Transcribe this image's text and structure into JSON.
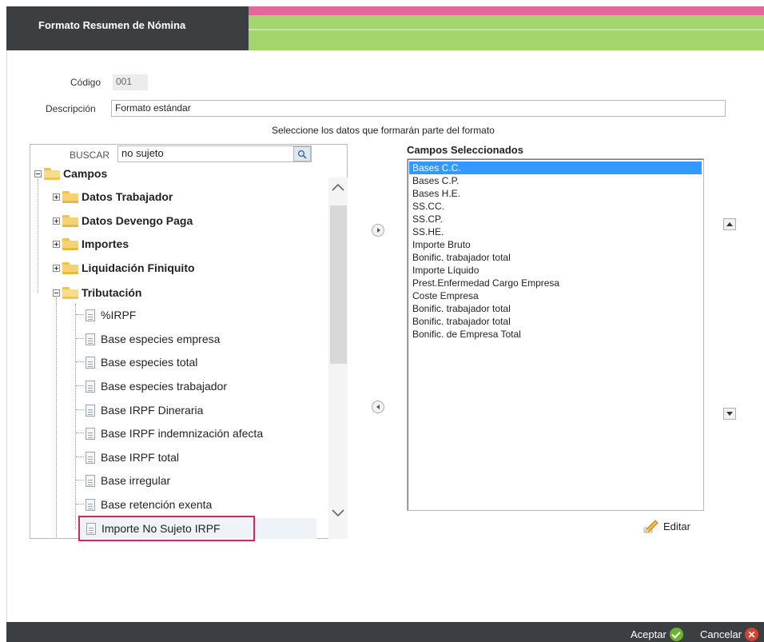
{
  "header": {
    "title": "Formato Resumen de Nómina"
  },
  "form": {
    "codigo_label": "Código",
    "codigo_value": "001",
    "descripcion_label": "Descripción",
    "descripcion_value": "Formato estándar",
    "instruction": "Seleccione los datos que formarán parte del formato"
  },
  "search": {
    "label": "BUSCAR",
    "value": "no sujeto"
  },
  "tree": {
    "root": "Campos",
    "folders": [
      {
        "label": "Datos Trabajador",
        "expanded": false
      },
      {
        "label": "Datos Devengo Paga",
        "expanded": false
      },
      {
        "label": "Importes",
        "expanded": false
      },
      {
        "label": "Liquidación Finiquito",
        "expanded": false
      },
      {
        "label": "Tributación",
        "expanded": true
      }
    ],
    "leaves": [
      "%IRPF",
      "Base especies empresa",
      "Base especies total",
      "Base especies trabajador",
      "Base IRPF Dineraria",
      "Base IRPF indemnización afecta",
      "Base IRPF total",
      "Base irregular",
      "Base retención exenta",
      "Importe No Sujeto IRPF"
    ],
    "highlighted_leaf": "Importe No Sujeto IRPF",
    "highlight_color": "#d6245f"
  },
  "selected": {
    "title": "Campos Seleccionados",
    "items": [
      "Bases C.C.",
      "Bases C.P.",
      "Bases H.E.",
      "SS.CC.",
      "SS.CP.",
      "SS.HE.",
      "Importe Bruto",
      "Bonific. trabajador total",
      "Importe Líquido",
      "Prest.Enfermedad Cargo Empresa",
      "Coste Empresa",
      "Bonific. trabajador total",
      "Bonific. trabajador total",
      "Bonific. de Empresa Total"
    ],
    "active_index": 0
  },
  "actions": {
    "edit": "Editar"
  },
  "footer": {
    "accept": "Aceptar",
    "cancel": "Cancelar"
  },
  "colors": {
    "header_dark": "#3b3f42",
    "header_pink": "#e2679a",
    "header_green": "#a4d56d",
    "selection_blue": "#3399ff"
  },
  "icons": {
    "folder": "folder-icon",
    "document": "document-icon",
    "search": "search-icon",
    "edit": "pencil-icon",
    "accept": "check-circle-icon",
    "cancel": "close-circle-icon"
  }
}
